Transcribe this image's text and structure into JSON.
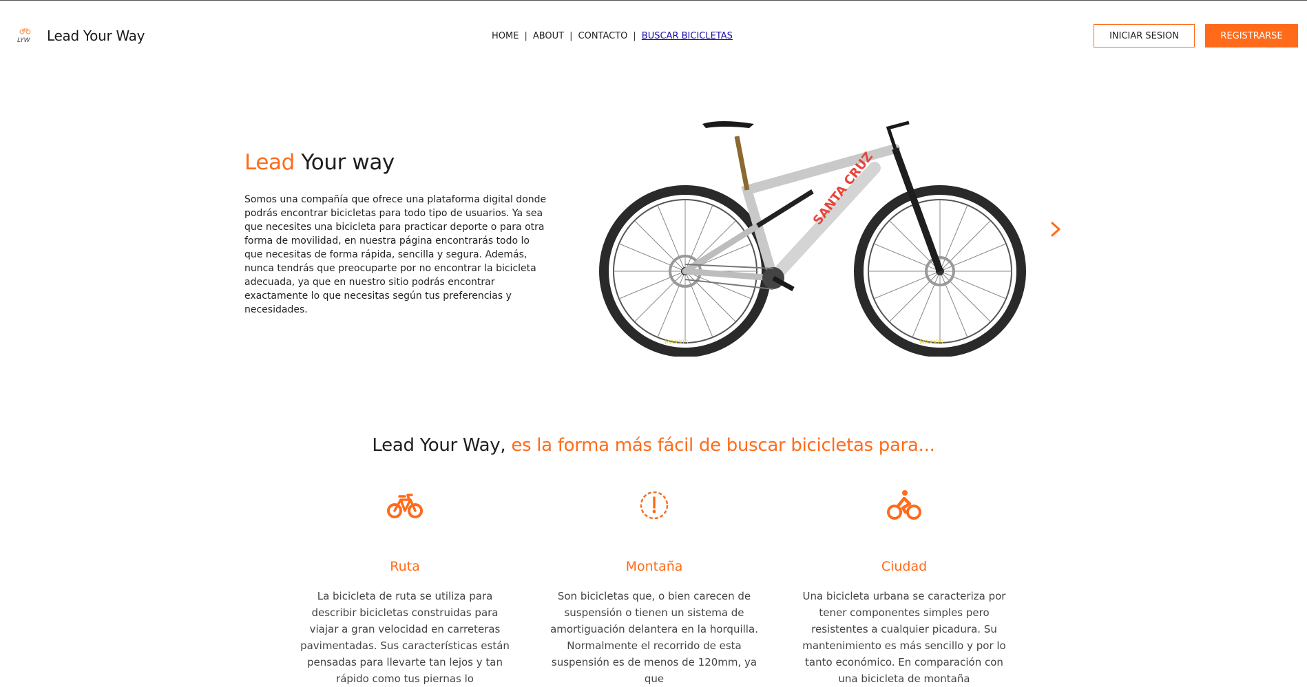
{
  "brand": {
    "logo_text": "Lead Your Way",
    "logo_icon": "bike-logo-icon",
    "accent_color": "#ff6b1a"
  },
  "nav": {
    "items": [
      "HOME",
      "ABOUT",
      "CONTACTO"
    ],
    "separator": "|",
    "active": "BUSCAR BICICLETAS"
  },
  "header": {
    "login_label": "INICIAR SESION",
    "register_label": "REGISTRARSE"
  },
  "hero": {
    "title_accent": "Lead",
    "title_rest": "Your way",
    "text": "Somos una compañía que ofrece una plataforma digital donde podrás encontrar bicicletas para todo tipo de usuarios. Ya sea que necesites una bicicleta para practicar deporte o para otra forma de movilidad, en nuestra página encontrarás todo lo que necesitas de forma rápida, sencilla y segura. Además, nunca tendrás que preocuparte por no encontrar la bicicleta adecuada, ya que en nuestro sitio podrás encontrar exactamente lo que necesitas según tus preferencias y necesidades.",
    "next_icon": "chevron-right-icon"
  },
  "section": {
    "title_dark": "Lead Your Way,",
    "title_accent": "es la forma más fácil de buscar bicicletas para...",
    "categories": [
      {
        "name": "Ruta",
        "icon": "road-bike-icon",
        "desc": "La bicicleta de ruta se utiliza para describir bicicletas construidas para viajar a gran velocidad en carreteras pavimentadas. Sus características están pensadas para llevarte tan lejos y tan rápido como tus piernas lo"
      },
      {
        "name": "Montaña",
        "icon": "alert-circle-icon",
        "desc": "Son bicicletas que, o bien carecen de suspensión o tienen un sistema de amortiguación delantera en la horquilla. Normalmente el recorrido de esta suspensión es de menos de 120mm, ya que"
      },
      {
        "name": "Ciudad",
        "icon": "cyclist-icon",
        "desc": "Una bicicleta urbana se caracteriza por tener componentes simples pero resistentes a cualquier picadura. Su mantenimiento es más sencillo y por lo tanto económico. En comparación con una bicicleta de montaña"
      }
    ]
  }
}
